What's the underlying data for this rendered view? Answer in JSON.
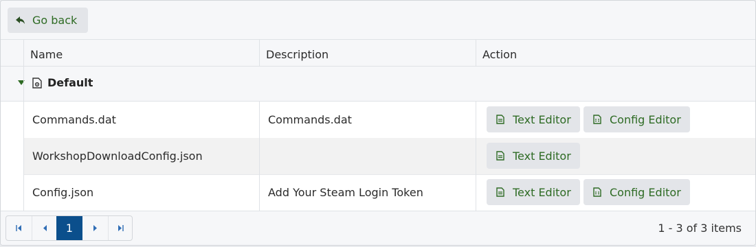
{
  "toolbar": {
    "go_back_label": "Go back"
  },
  "columns": [
    "Name",
    "Description",
    "Action"
  ],
  "group": {
    "label": "Default"
  },
  "rows": [
    {
      "name": "Commands.dat",
      "description": "Commands.dat",
      "actions": [
        "Text Editor",
        "Config Editor"
      ]
    },
    {
      "name": "WorkshopDownloadConfig.json",
      "description": "",
      "actions": [
        "Text Editor"
      ]
    },
    {
      "name": "Config.json",
      "description": "Add Your Steam Login Token",
      "actions": [
        "Text Editor",
        "Config Editor"
      ]
    }
  ],
  "pager": {
    "current_page": "1",
    "info": "1 - 3 of 3 items"
  },
  "colors": {
    "accent": "#0b4f8c",
    "button_text": "#2e6b24",
    "button_bg": "#e3e5e9"
  }
}
